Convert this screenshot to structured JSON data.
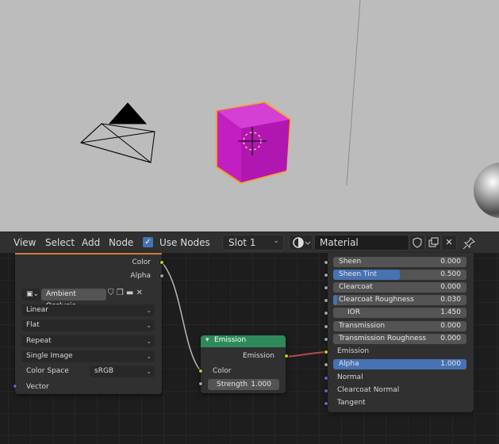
{
  "header": {
    "view": "View",
    "select": "Select",
    "add": "Add",
    "node": "Node",
    "use_nodes_label": "Use Nodes",
    "use_nodes_checked": true,
    "slot": "Slot 1",
    "material_name": "Material"
  },
  "image_node": {
    "outputs": {
      "color": "Color",
      "alpha": "Alpha"
    },
    "image_name": "Ambient Occlusio..",
    "interpolation": "Linear",
    "projection": "Flat",
    "extension": "Repeat",
    "source": "Single Image",
    "color_space_label": "Color Space",
    "color_space": "sRGB",
    "vector_label": "Vector"
  },
  "emission_node": {
    "title": "Emission",
    "output": "Emission",
    "color_label": "Color",
    "strength_label": "Strength",
    "strength_value": "1.000",
    "header_color": "#2f8a5b"
  },
  "principled_node": {
    "rows": [
      {
        "label": "Sheen",
        "value": "0.000"
      },
      {
        "label": "Sheen Tint",
        "value": "0.500",
        "fill": 0.5
      },
      {
        "label": "Clearcoat",
        "value": "0.000"
      },
      {
        "label": "Clearcoat Roughness",
        "value": "0.030",
        "fill": 0.03
      },
      {
        "label": "IOR",
        "value": "1.450"
      },
      {
        "label": "Transmission",
        "value": "0.000"
      },
      {
        "label": "Transmission Roughness",
        "value": "0.000"
      }
    ],
    "emission_label": "Emission",
    "alpha": {
      "label": "Alpha",
      "value": "1.000",
      "fill": 1.0
    },
    "vector_inputs": [
      "Normal",
      "Clearcoat Normal",
      "Tangent"
    ]
  },
  "colors": {
    "accent": "#4772b3",
    "viewport_bg": "#bcbcbc",
    "cube": "#c21fc2",
    "selection_outline": "#f5a02b",
    "socket_yellow": "#c7c729",
    "socket_grey": "#a1a1a1",
    "socket_purple": "#6363c7"
  }
}
